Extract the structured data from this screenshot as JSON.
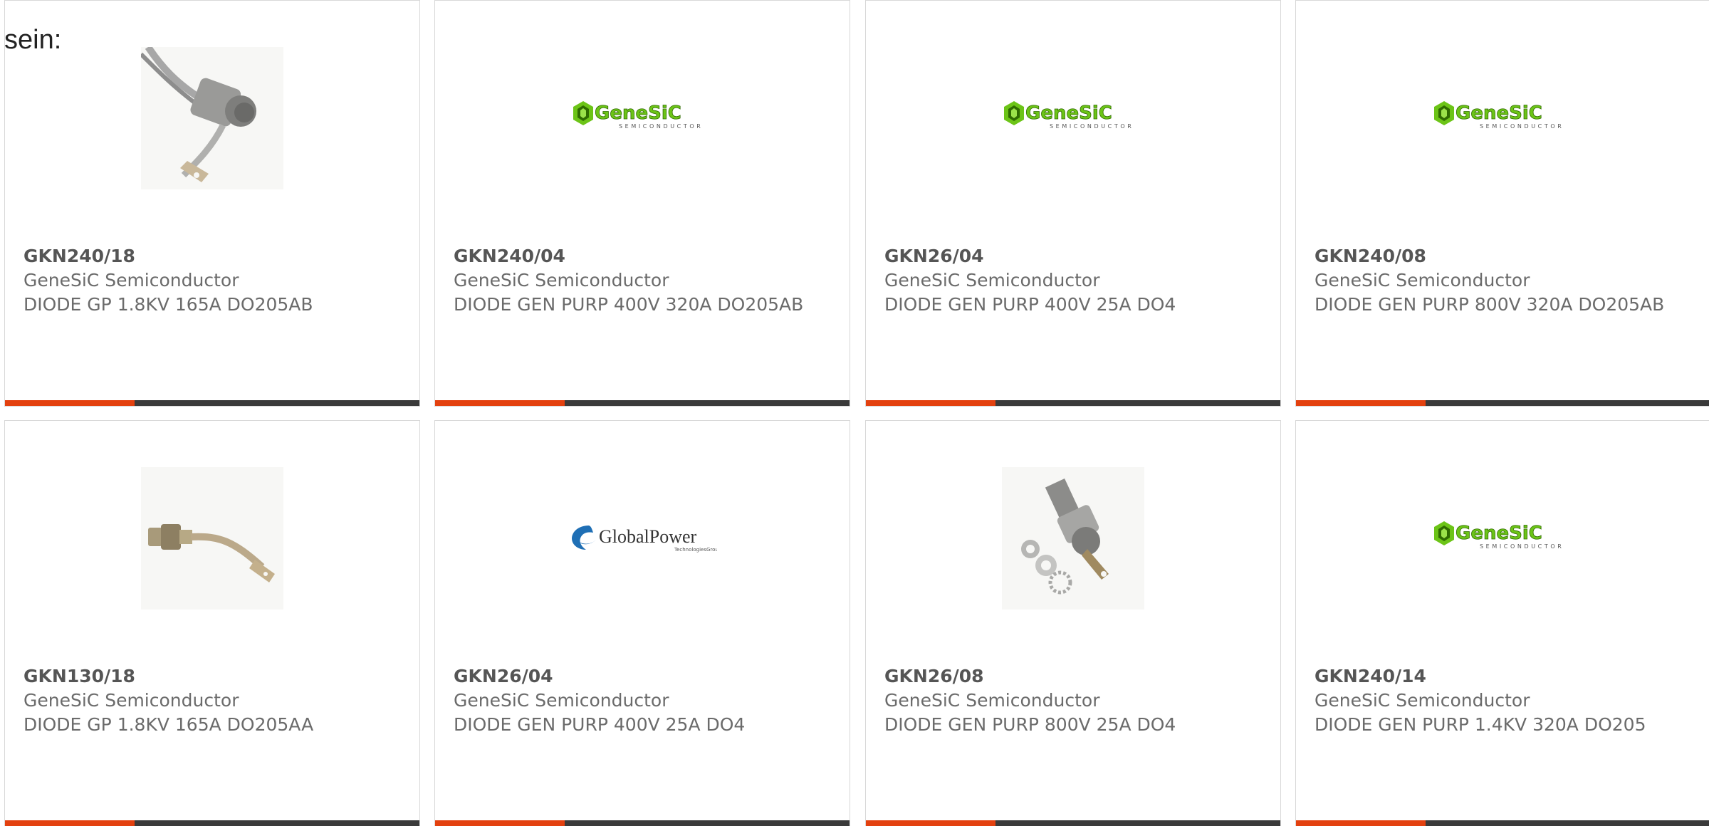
{
  "leading_text": "sein:",
  "colors": {
    "accent": "#e3410f",
    "bar": "#3a3a3a",
    "genesic_green": "#6cc417",
    "globalpower_blue": "#1f6fb5"
  },
  "products": [
    {
      "part_number": "GKN240/18",
      "manufacturer": "GeneSiC Semiconductor",
      "description": "DIODE GP 1.8KV 165A DO205AB",
      "image": "stud-diode-braided-lead-photo"
    },
    {
      "part_number": "GKN240/04",
      "manufacturer": "GeneSiC Semiconductor",
      "description": "DIODE GEN PURP 400V 320A DO205AB",
      "image": "genesic-logo"
    },
    {
      "part_number": "GKN26/04",
      "manufacturer": "GeneSiC Semiconductor",
      "description": "DIODE GEN PURP 400V 25A DO4",
      "image": "genesic-logo"
    },
    {
      "part_number": "GKN240/08",
      "manufacturer": "GeneSiC Semiconductor",
      "description": "DIODE GEN PURP 800V 320A DO205AB",
      "image": "genesic-logo"
    },
    {
      "part_number": "GKN130/18",
      "manufacturer": "GeneSiC Semiconductor",
      "description": "DIODE GP 1.8KV 165A DO205AA",
      "image": "stud-diode-bent-lead-photo"
    },
    {
      "part_number": "GKN26/04",
      "manufacturer": "GeneSiC Semiconductor",
      "description": "DIODE GEN PURP 400V 25A DO4",
      "image": "globalpower-logo"
    },
    {
      "part_number": "GKN26/08",
      "manufacturer": "GeneSiC Semiconductor",
      "description": "DIODE GEN PURP 800V 25A DO4",
      "image": "stud-diode-with-hardware-photo"
    },
    {
      "part_number": "GKN240/14",
      "manufacturer": "GeneSiC Semiconductor",
      "description": "DIODE GEN PURP 1.4KV 320A DO205",
      "image": "genesic-logo"
    }
  ],
  "logos": {
    "genesic": {
      "name": "GeneSiC",
      "tagline": "SEMICONDUCTOR"
    },
    "globalpower": {
      "name": "GlobalPower",
      "tagline": "TechnologiesGroup"
    }
  }
}
